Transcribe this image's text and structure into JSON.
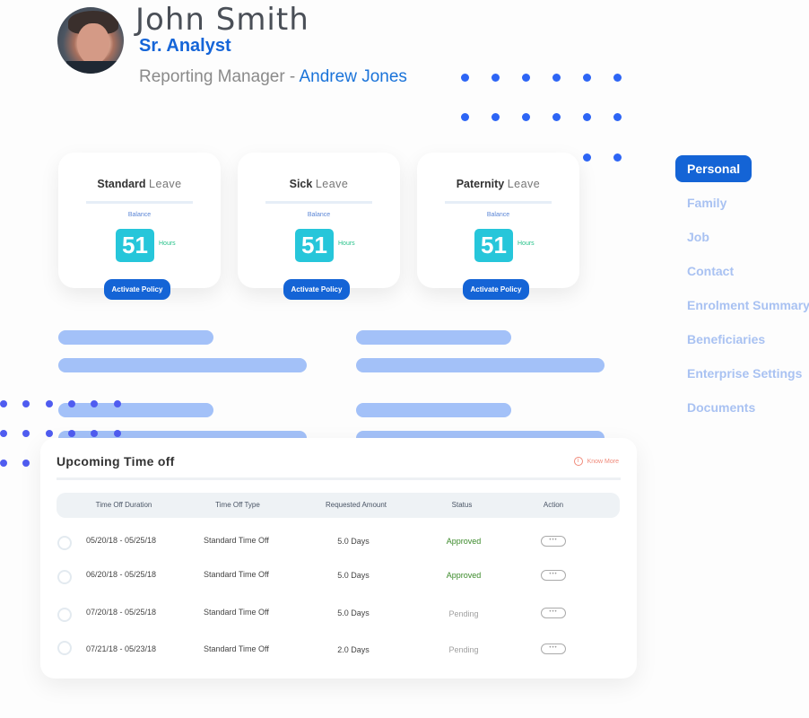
{
  "profile": {
    "name": "John Smith",
    "title": "Sr. Analyst",
    "manager_label": "Reporting Manager - ",
    "manager_name": "Andrew Jones"
  },
  "leave_cards": [
    {
      "type_bold": "Standard",
      "type_light": "Leave",
      "balance_label": "Balance",
      "value": "51",
      "unit": "Hours",
      "button": "Activate Policy"
    },
    {
      "type_bold": "Sick",
      "type_light": "Leave",
      "balance_label": "Balance",
      "value": "51",
      "unit": "Hours",
      "button": "Activate Policy"
    },
    {
      "type_bold": "Paternity",
      "type_light": "Leave",
      "balance_label": "Balance",
      "value": "51",
      "unit": "Hours",
      "button": "Activate Policy"
    }
  ],
  "nav": {
    "items": [
      {
        "label": "Personal",
        "active": true
      },
      {
        "label": "Family"
      },
      {
        "label": "Job"
      },
      {
        "label": "Contact"
      },
      {
        "label": "Enrolment Summary"
      },
      {
        "label": "Beneficiaries"
      },
      {
        "label": "Enterprise Settings"
      },
      {
        "label": "Documents"
      }
    ]
  },
  "timeoff": {
    "title": "Upcoming Time off",
    "know_more": "Know More",
    "info_icon": "i",
    "columns": [
      "Time Off Duration",
      "Time Off Type",
      "Requested Amount",
      "Status",
      "Action"
    ],
    "rows": [
      {
        "duration": "05/20/18 - 05/25/18",
        "type": "Standard Time Off",
        "amount": "5.0 Days",
        "status": "Approved",
        "action": "•••"
      },
      {
        "duration": "06/20/18 - 05/25/18",
        "type": "Standard Time Off",
        "amount": "5.0 Days",
        "status": "Approved",
        "action": "•••"
      },
      {
        "duration": "07/20/18 - 05/25/18",
        "type": "Standard Time Off",
        "amount": "5.0 Days",
        "status": "Pending",
        "action": "•••"
      },
      {
        "duration": "07/21/18 - 05/23/18",
        "type": "Standard Time Off",
        "amount": "2.0 Days",
        "status": "Pending",
        "action": "•••"
      }
    ]
  },
  "colors": {
    "accent": "#1464d6",
    "tile": "#26c6da",
    "approved": "#3b8a2a",
    "pending": "#a0a0a0",
    "placeholder_bar": "#a3c1f8",
    "dots_blue": "#2d65f5",
    "dots_purple": "#4f5cf0"
  }
}
